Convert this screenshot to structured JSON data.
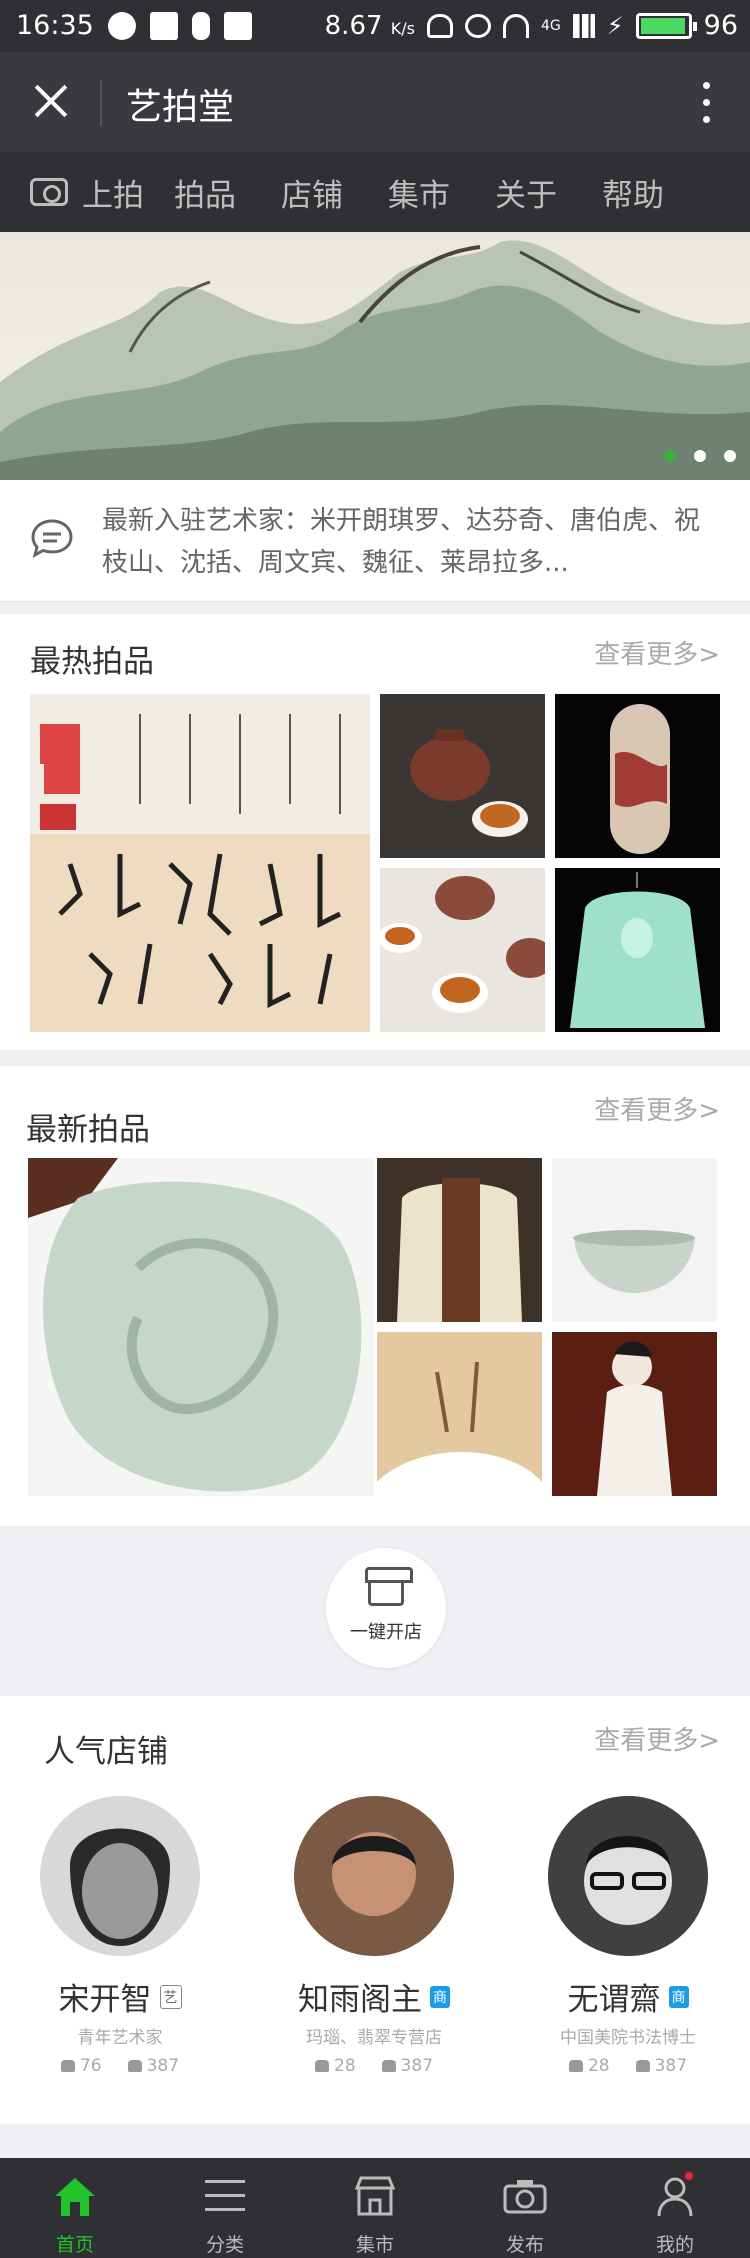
{
  "status_bar": {
    "time": "16:35",
    "net_speed": "8.67",
    "speed_unit": "K/s",
    "signal": "4G",
    "battery": "96",
    "battery_level": 0.96
  },
  "titlebar": {
    "title": "艺拍堂"
  },
  "nav": {
    "items": [
      "上拍",
      "拍品",
      "店铺",
      "集市",
      "关于",
      "帮助"
    ]
  },
  "notice": {
    "text": "最新入驻艺术家：米开朗琪罗、达芬奇、唐伯虎、祝枝山、沈括、周文宾、魏征、莱昂拉多..."
  },
  "hot": {
    "title": "最热拍品",
    "more": "查看更多>"
  },
  "latest": {
    "title": "最新拍品",
    "more": "查看更多>"
  },
  "open_shop": {
    "label": "一键开店"
  },
  "shops": {
    "title": "人气店铺",
    "more": "查看更多>",
    "items": [
      {
        "name": "宋开智",
        "badge": "艺",
        "desc": "青年艺术家",
        "products": "76",
        "followers": "387"
      },
      {
        "name": "知雨阁主",
        "badge": "商",
        "desc": "玛瑙、翡翠专营店",
        "products": "28",
        "followers": "387"
      },
      {
        "name": "无谓齋",
        "badge": "商",
        "desc": "中国美院书法博士",
        "products": "28",
        "followers": "387"
      }
    ]
  },
  "tabbar": {
    "items": [
      {
        "label": "首页",
        "icon": "home-icon"
      },
      {
        "label": "分类",
        "icon": "menu-icon"
      },
      {
        "label": "集市",
        "icon": "shop-icon"
      },
      {
        "label": "发布",
        "icon": "camera-icon"
      },
      {
        "label": "我的",
        "icon": "user-icon"
      }
    ]
  },
  "colors": {
    "accent": "#21c42b",
    "dark_bar": "#2f3033",
    "title_bar": "#393a3f",
    "badge_blue": "#1e9be8"
  }
}
